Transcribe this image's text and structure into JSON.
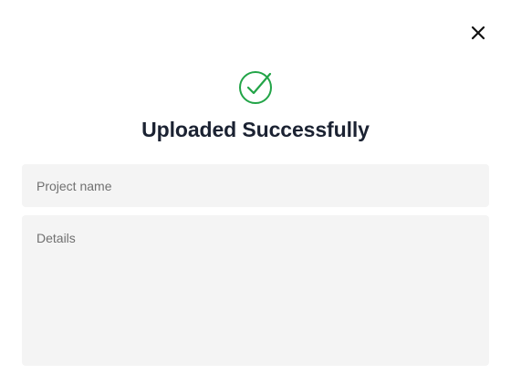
{
  "dialog": {
    "title": "Uploaded Successfully",
    "icons": {
      "close": "close-icon",
      "success": "check-circle-icon"
    },
    "colors": {
      "success": "#22a447",
      "title": "#1b2232",
      "field_background": "#f4f4f4"
    },
    "fields": {
      "project_name": {
        "value": "",
        "placeholder": "Project name"
      },
      "details": {
        "value": "",
        "placeholder": "Details"
      }
    }
  }
}
